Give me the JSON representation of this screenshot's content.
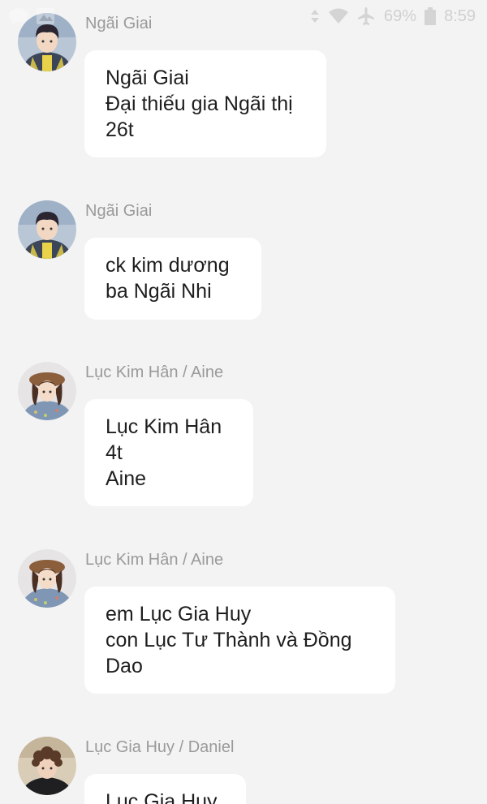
{
  "status_bar": {
    "battery_percent": "69%",
    "time": "8:59",
    "icons": [
      "chat-bubble-icon",
      "image-icon",
      "signal-icon",
      "wifi-icon",
      "airplane-mode-icon",
      "battery-icon"
    ]
  },
  "messages": [
    {
      "sender": "Ngãi Giai",
      "avatar": "avatar-boy-plaid-icon",
      "lines": [
        "Ngãi Giai",
        "Đại thiếu gia Ngãi thị",
        "26t"
      ]
    },
    {
      "sender": "Ngãi Giai",
      "avatar": "avatar-boy-plaid-icon",
      "lines": [
        "ck kim dương",
        "ba Ngãi Nhi"
      ]
    },
    {
      "sender": "Lục Kim Hân / Aine",
      "avatar": "avatar-girl-hat-icon",
      "lines": [
        "Lục Kim Hân",
        "4t",
        "Aine"
      ]
    },
    {
      "sender": "Lục Kim Hân / Aine",
      "avatar": "avatar-girl-hat-icon",
      "lines": [
        "em Lục Gia Huy",
        "con Lục Tư Thành và Đồng",
        "Dao"
      ]
    },
    {
      "sender": "Lục Gia Huy / Daniel",
      "avatar": "avatar-boy-curly-icon",
      "lines": [
        "Lục Gia Huy"
      ]
    }
  ]
}
